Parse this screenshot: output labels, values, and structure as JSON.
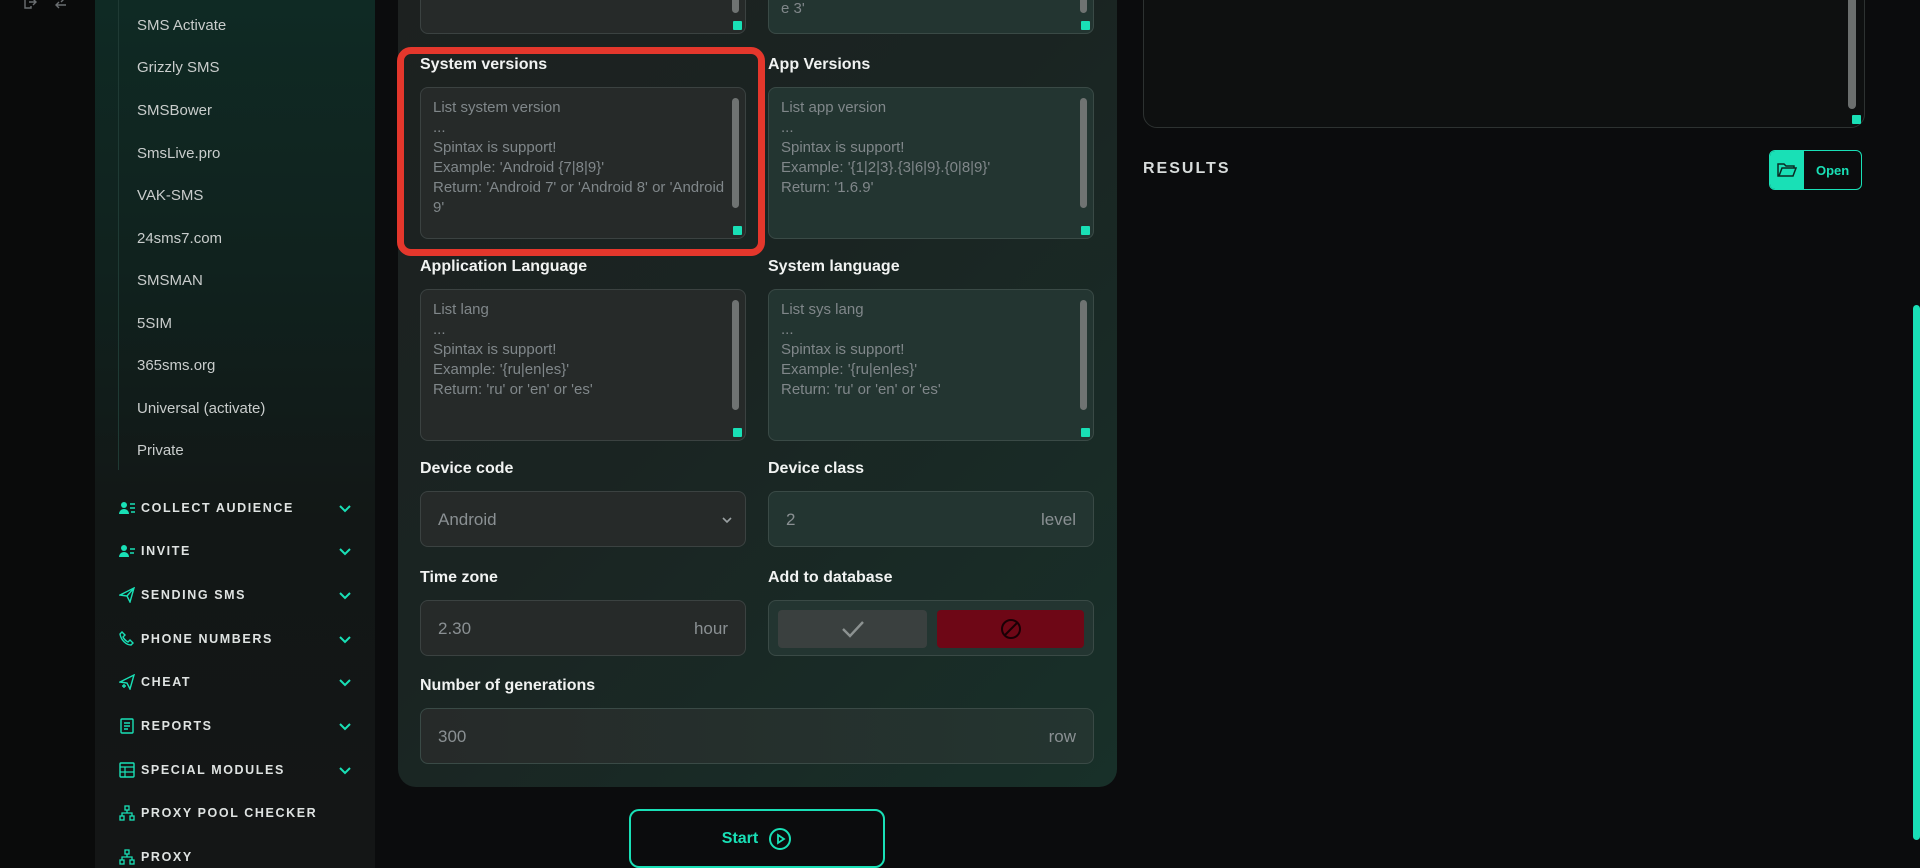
{
  "rail": {
    "icons": [
      "logout-icon",
      "switch-icon"
    ]
  },
  "sidebar": {
    "sub_items": [
      "SMS Activate",
      "Grizzly SMS",
      "SMSBower",
      "SmsLive.pro",
      "VAK-SMS",
      "24sms7.com",
      "SMSMAN",
      "5SIM",
      "365sms.org",
      "Universal (activate)",
      "Private"
    ],
    "sections": [
      {
        "label": "COLLECT AUDIENCE",
        "icon": "users-list-icon",
        "expandable": true
      },
      {
        "label": "INVITE",
        "icon": "user-add-icon",
        "expandable": true
      },
      {
        "label": "SENDING SMS",
        "icon": "send-icon",
        "expandable": true
      },
      {
        "label": "PHONE NUMBERS",
        "icon": "phone-icon",
        "expandable": true
      },
      {
        "label": "CHEAT",
        "icon": "send-plus-icon",
        "expandable": true
      },
      {
        "label": "REPORTS",
        "icon": "report-icon",
        "expandable": true
      },
      {
        "label": "SPECIAL MODULES",
        "icon": "table-icon",
        "expandable": true
      },
      {
        "label": "PROXY POOL CHECKER",
        "icon": "network-icon",
        "expandable": false
      },
      {
        "label": "PROXY",
        "icon": "network-icon",
        "expandable": false
      }
    ]
  },
  "form": {
    "top_left_tail": "",
    "top_right_tail": "e 3'",
    "system_versions": {
      "label": "System versions",
      "placeholder": "List system version\n...\nSpintax is support!\nExample: 'Android {7|8|9}'\nReturn: 'Android 7' or 'Android 8' or 'Android 9'"
    },
    "app_versions": {
      "label": "App Versions",
      "placeholder": "List app version\n...\nSpintax is support!\nExample: '{1|2|3}.{3|6|9}.{0|8|9}'\nReturn: '1.6.9'"
    },
    "application_language": {
      "label": "Application Language",
      "placeholder": "List lang\n...\nSpintax is support!\nExample: '{ru|en|es}'\nReturn: 'ru' or 'en' or 'es'"
    },
    "system_language": {
      "label": "System language",
      "placeholder": "List sys lang\n...\nSpintax is support!\nExample: '{ru|en|es}'\nReturn: 'ru' or 'en' or 'es'"
    },
    "device_code": {
      "label": "Device code",
      "value": "Android"
    },
    "device_class": {
      "label": "Device class",
      "value": "2",
      "unit": "level"
    },
    "time_zone": {
      "label": "Time zone",
      "value": "2.30",
      "unit": "hour"
    },
    "add_to_database": {
      "label": "Add to database",
      "selected": "off"
    },
    "generations": {
      "label": "Number of generations",
      "value": "300",
      "unit": "row"
    }
  },
  "start_button": {
    "label": "Start"
  },
  "results": {
    "title": "RESULTS",
    "open_label": "Open"
  },
  "colors": {
    "accent": "#19e0b6",
    "highlight": "#e4372c",
    "off_button": "#6e0716"
  }
}
